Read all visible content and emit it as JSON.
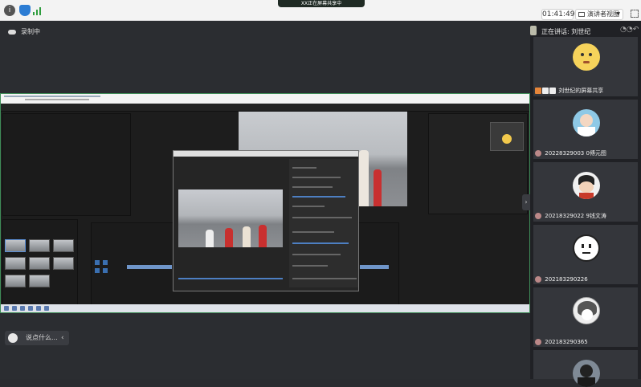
{
  "topbar": {
    "meeting_title": "XX正在屏幕共享中",
    "clock": "01:41:49",
    "view_button": "演讲者视图"
  },
  "main": {
    "recording_label": "录制中",
    "chat_placeholder": "说点什么..."
  },
  "sidebar": {
    "speaking_label": "正在讲话: 刘世纪",
    "participants": [
      {
        "name": "刘世纪的屏幕共享",
        "avatar": "emoji-face"
      },
      {
        "name": "20228329003 0傅元图",
        "avatar": "cartoon-boy"
      },
      {
        "name": "20218329022 9钱文涛",
        "avatar": "crayon-shin"
      },
      {
        "name": "202183290226",
        "avatar": "white-face"
      },
      {
        "name": "202183290365",
        "avatar": "anime-girl"
      },
      {
        "name": "",
        "avatar": "dark-figure"
      }
    ]
  },
  "colors": {
    "accent": "#3f8d58",
    "sidebar_bg": "#202125",
    "main_bg": "#2b2d31"
  }
}
